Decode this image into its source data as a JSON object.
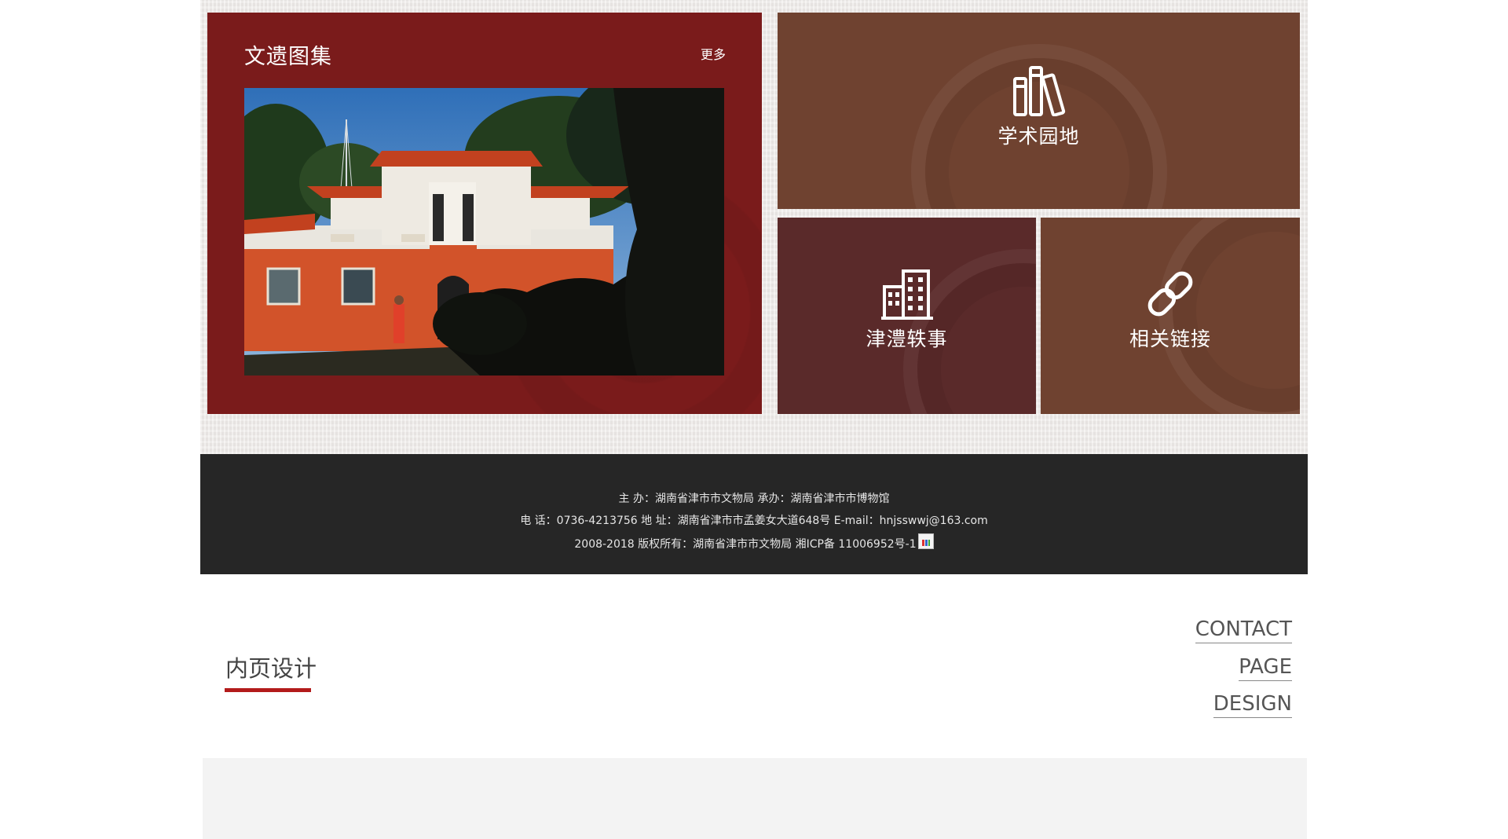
{
  "gallery": {
    "title": "文遗图集",
    "more_link": "更多",
    "photo_alt": "文遗图集照片"
  },
  "tiles": {
    "academic": {
      "label": "学术园地",
      "icon": "books-icon"
    },
    "anecdotes": {
      "label": "津澧轶事",
      "icon": "building-icon"
    },
    "links": {
      "label": "相关链接",
      "icon": "link-icon"
    }
  },
  "footer": {
    "line1": "主 办：湖南省津市市文物局    承办：湖南省津市市博物馆",
    "line2": "电 话：0736-4213756    地 址：湖南省津市市孟姜女大道648号    E-mail：hnjsswwj@163.com",
    "line3": "2008-2018 版权所有：湖南省津市市文物局 湘ICP备 11006952号-1"
  },
  "design_section": {
    "heading": "内页设计",
    "words": [
      "CONTACT",
      "PAGE",
      "DESIGN"
    ]
  },
  "colors": {
    "gallery_red": "#7a1b1b",
    "tile_brown": "#6f4230",
    "tile_maroon": "#5a2a2a",
    "footer_dark": "#262626",
    "accent_red": "#b31b1b"
  }
}
